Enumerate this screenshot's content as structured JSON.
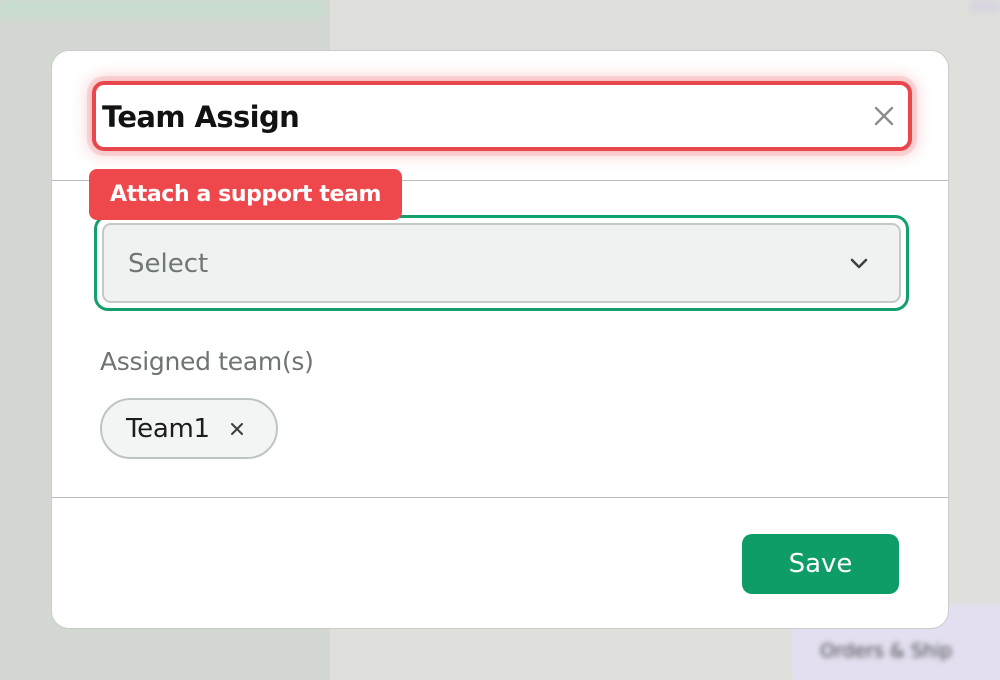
{
  "background": {
    "partial_label": "Orders & Ship"
  },
  "modal": {
    "title_value": "Team Assign",
    "tooltip": "Attach a support team",
    "team_select": {
      "placeholder": "Select"
    },
    "assigned_label": "Assigned team(s)",
    "assigned_teams": [
      {
        "label": "Team1"
      }
    ],
    "save_label": "Save"
  },
  "icons": {
    "clear": "close-icon",
    "dropdown": "chevron-down-icon",
    "chip_remove": "close-icon"
  },
  "colors": {
    "error_red": "#e9474d",
    "tooltip_red": "#ee484d",
    "focus_green": "#13a06b",
    "save_green": "#0f9d67"
  }
}
